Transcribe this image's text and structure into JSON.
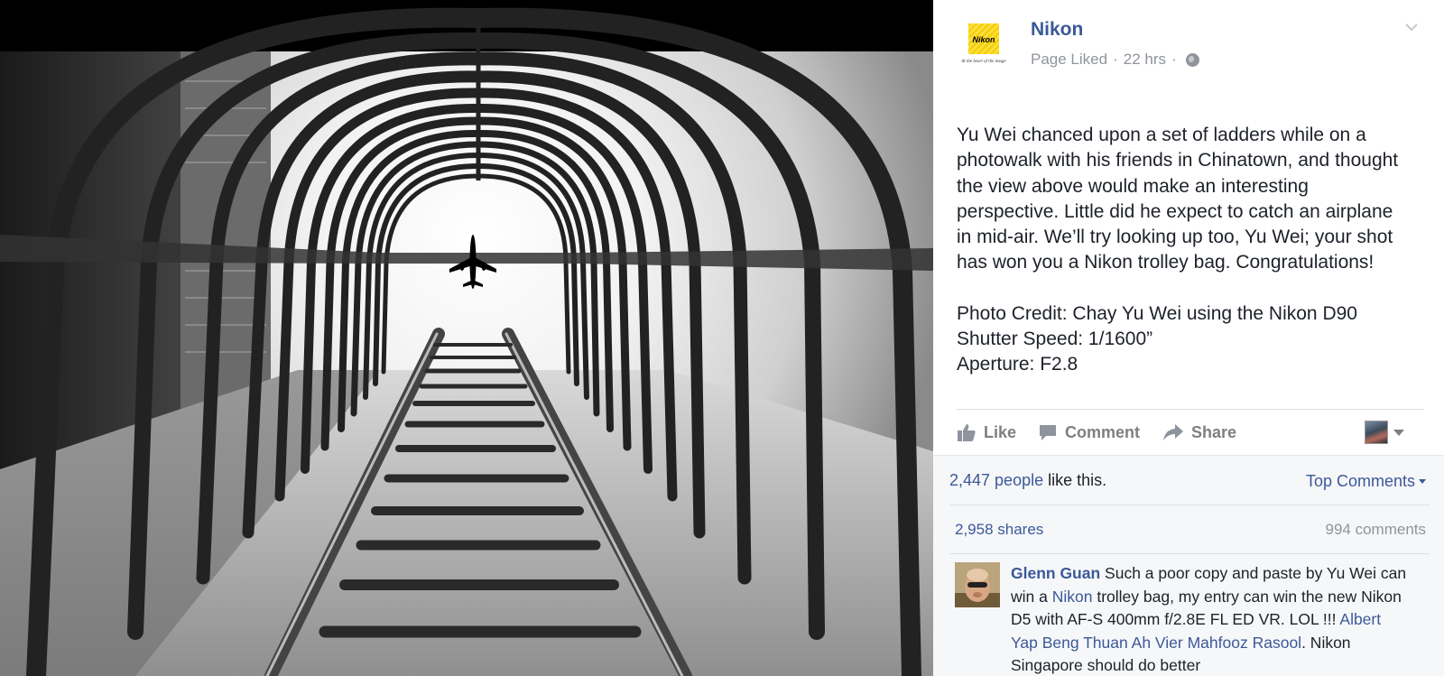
{
  "post": {
    "page_name": "Nikon",
    "logo_word": "Nikon",
    "logo_tagline": "At the heart of the image",
    "meta": {
      "status": "Page Liked",
      "sep1": "·",
      "time": "22 hrs",
      "sep2": "·"
    },
    "text_lines": [
      "Yu Wei chanced upon a set of ladders while on a",
      "photowalk with his friends in Chinatown, and thought",
      "the view above would make an interesting",
      "perspective. Little did he expect to catch an airplane",
      "in mid-air. We’ll try looking up too, Yu Wei; your shot",
      "has won you a Nikon trolley bag. Congratulations!"
    ],
    "credit_lines": [
      "Photo Credit: Chay Yu Wei using the Nikon D90",
      "Shutter Speed: 1/1600”",
      "Aperture: F2.8"
    ]
  },
  "actions": {
    "like": "Like",
    "comment": "Comment",
    "share": "Share"
  },
  "feedback": {
    "likes_link": "2,447 people",
    "likes_suffix": " like this.",
    "top_comments": "Top Comments",
    "shares": "2,958 shares",
    "comments": "994 comments"
  },
  "comment": {
    "author": "Glenn Guan",
    "t1": " Such a poor copy and paste by Yu Wei can win a ",
    "link1": "Nikon",
    "t2": " trolley bag, my entry can win the new Nikon D5 with AF-S 400mm f/2.8E FL ED VR. LOL !!! ",
    "link2": "Albert Yap Beng Thuan",
    "sp": " ",
    "link3": "Ah Vier",
    "sp2": " ",
    "link4": "Mahfooz Rasool",
    "t3": ". Nikon Singapore should do better"
  },
  "colors": {
    "link": "#3b5998",
    "muted": "#90949c",
    "text": "#1d2129",
    "feedback_bg": "#f6f7f9"
  },
  "icons": {
    "like": "thumbs-up-icon",
    "comment": "speech-bubble-icon",
    "share": "share-arrow-icon",
    "privacy": "globe-icon",
    "options": "chevron-down-icon"
  }
}
